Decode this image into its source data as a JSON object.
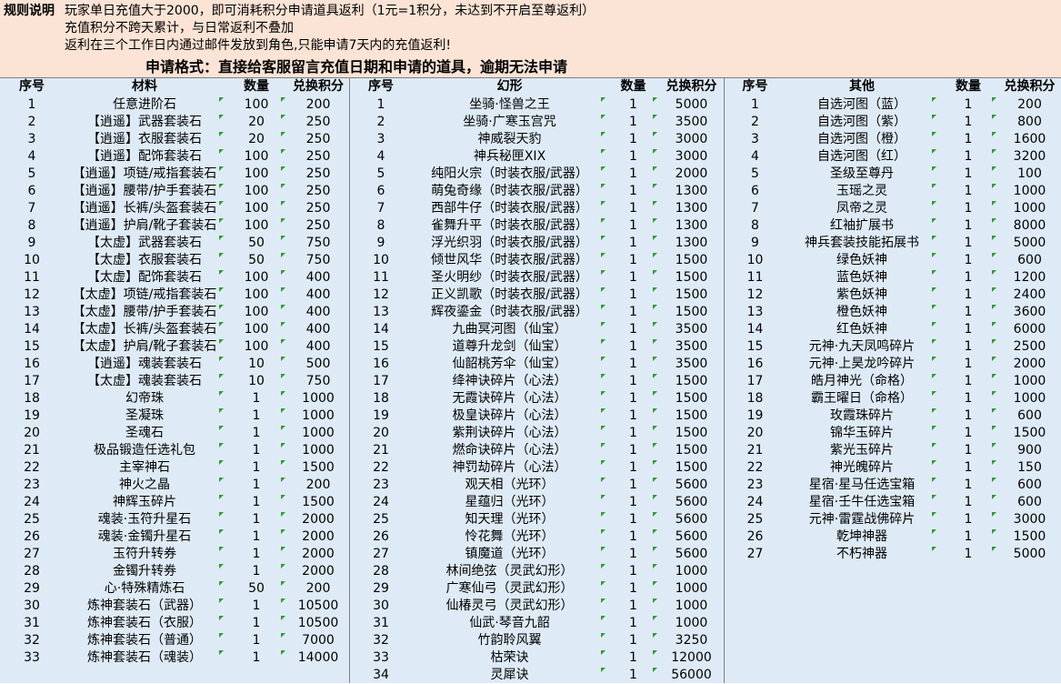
{
  "rules": {
    "label": "规则说明",
    "line1": "玩家单日充值大于2000，即可消耗积分申请道具返利（1元=1积分，未达到不开启至尊返利）",
    "line2": "充值积分不跨天累计，与日常返利不叠加",
    "line3": "返利在三个工作日内通过邮件发放到角色,只能申请7天内的充值返利!",
    "format": "申请格式：直接给客服留言充值日期和申请的道具，逾期无法申请"
  },
  "sections": [
    {
      "headers": [
        "序号",
        "材料",
        "数量",
        "兑换积分"
      ],
      "rows": [
        [
          "1",
          "任意进阶石",
          "100",
          "200"
        ],
        [
          "2",
          "【逍遥】武器套装石",
          "20",
          "250"
        ],
        [
          "3",
          "【逍遥】衣服套装石",
          "20",
          "250"
        ],
        [
          "4",
          "【逍遥】配饰套装石",
          "100",
          "250"
        ],
        [
          "5",
          "【逍遥】项链/戒指套装石",
          "100",
          "250"
        ],
        [
          "6",
          "【逍遥】腰带/护手套装石",
          "100",
          "250"
        ],
        [
          "7",
          "【逍遥】长裤/头盔套装石",
          "100",
          "250"
        ],
        [
          "8",
          "【逍遥】护肩/靴子套装石",
          "100",
          "250"
        ],
        [
          "9",
          "【太虚】武器套装石",
          "50",
          "750"
        ],
        [
          "10",
          "【太虚】衣服套装石",
          "50",
          "750"
        ],
        [
          "11",
          "【太虚】配饰套装石",
          "100",
          "400"
        ],
        [
          "12",
          "【太虚】项链/戒指套装石",
          "100",
          "400"
        ],
        [
          "13",
          "【太虚】腰带/护手套装石",
          "100",
          "400"
        ],
        [
          "14",
          "【太虚】长裤/头盔套装石",
          "100",
          "400"
        ],
        [
          "15",
          "【太虚】护肩/靴子套装石",
          "100",
          "400"
        ],
        [
          "16",
          "【逍遥】魂装套装石",
          "10",
          "500"
        ],
        [
          "17",
          "【太虚】魂装套装石",
          "10",
          "750"
        ],
        [
          "18",
          "幻帝珠",
          "1",
          "1000"
        ],
        [
          "19",
          "圣凝珠",
          "1",
          "1000"
        ],
        [
          "20",
          "圣魂石",
          "1",
          "1000"
        ],
        [
          "21",
          "极品锻造任选礼包",
          "1",
          "1000"
        ],
        [
          "22",
          "主宰神石",
          "1",
          "1500"
        ],
        [
          "23",
          "神火之晶",
          "1",
          "200"
        ],
        [
          "24",
          "神辉玉碎片",
          "1",
          "1500"
        ],
        [
          "25",
          "魂装·玉符升星石",
          "1",
          "2000"
        ],
        [
          "26",
          "魂装·金镯升星石",
          "1",
          "2000"
        ],
        [
          "27",
          "玉符升转券",
          "1",
          "2000"
        ],
        [
          "28",
          "金镯升转券",
          "1",
          "2000"
        ],
        [
          "29",
          "心·特殊精炼石",
          "50",
          "200"
        ],
        [
          "30",
          "炼神套装石（武器）",
          "1",
          "10500"
        ],
        [
          "31",
          "炼神套装石（衣服）",
          "1",
          "10500"
        ],
        [
          "32",
          "炼神套装石（普通）",
          "1",
          "7000"
        ],
        [
          "33",
          "炼神套装石（魂装）",
          "1",
          "14000"
        ]
      ]
    },
    {
      "headers": [
        "序号",
        "幻形",
        "数量",
        "兑换积分"
      ],
      "rows": [
        [
          "1",
          "坐骑·怪兽之王",
          "1",
          "5000"
        ],
        [
          "2",
          "坐骑·广寒玉宫咒",
          "1",
          "3500"
        ],
        [
          "3",
          "神威裂天豹",
          "1",
          "3000"
        ],
        [
          "4",
          "神兵秘匣XIX",
          "1",
          "3000"
        ],
        [
          "5",
          "纯阳火宗（时装衣服/武器）",
          "1",
          "2000"
        ],
        [
          "6",
          "萌兔奇缘（时装衣服/武器）",
          "1",
          "1300"
        ],
        [
          "7",
          "西部牛仔（时装衣服/武器）",
          "1",
          "1300"
        ],
        [
          "8",
          "雀舞升平（时装衣服/武器）",
          "1",
          "1300"
        ],
        [
          "9",
          "浮光织羽（时装衣服/武器）",
          "1",
          "1300"
        ],
        [
          "10",
          "倾世风华（时装衣服/武器）",
          "1",
          "1500"
        ],
        [
          "11",
          "圣火明纱（时装衣服/武器）",
          "1",
          "1500"
        ],
        [
          "12",
          "正义凯歌（时装衣服/武器）",
          "1",
          "1500"
        ],
        [
          "13",
          "辉夜鎏金（时装衣服/武器）",
          "1",
          "1500"
        ],
        [
          "14",
          "九曲冥河图（仙宝）",
          "1",
          "3500"
        ],
        [
          "15",
          "道尊升龙剑（仙宝）",
          "1",
          "3500"
        ],
        [
          "16",
          "仙韶桃芳伞（仙宝）",
          "1",
          "3500"
        ],
        [
          "17",
          "绛神诀碎片（心法）",
          "1",
          "1500"
        ],
        [
          "18",
          "无霞诀碎片（心法）",
          "1",
          "1500"
        ],
        [
          "19",
          "极皇诀碎片（心法）",
          "1",
          "1500"
        ],
        [
          "20",
          "紫荆诀碎片（心法）",
          "1",
          "1500"
        ],
        [
          "21",
          "燃命诀碎片（心法）",
          "1",
          "1500"
        ],
        [
          "22",
          "神罚劫碎片（心法）",
          "1",
          "1500"
        ],
        [
          "23",
          "观天相（光环）",
          "1",
          "5600"
        ],
        [
          "24",
          "星蕴归（光环）",
          "1",
          "5600"
        ],
        [
          "25",
          "知天理（光环）",
          "1",
          "5600"
        ],
        [
          "26",
          "怜花舞（光环）",
          "1",
          "5600"
        ],
        [
          "27",
          "镇魔道（光环）",
          "1",
          "5600"
        ],
        [
          "28",
          "林间绝弦（灵武幻形）",
          "1",
          "1000"
        ],
        [
          "29",
          "广寒仙弓（灵武幻形）",
          "1",
          "1000"
        ],
        [
          "30",
          "仙椿灵弓（灵武幻形）",
          "1",
          "1000"
        ],
        [
          "31",
          "仙武·琴音九韶",
          "1",
          "1000"
        ],
        [
          "32",
          "竹韵聆风翼",
          "1",
          "3250"
        ],
        [
          "33",
          "枯荣诀",
          "1",
          "12000"
        ],
        [
          "34",
          "灵犀诀",
          "1",
          "56000"
        ]
      ]
    },
    {
      "headers": [
        "序号",
        "其他",
        "数量",
        "兑换积分"
      ],
      "rows": [
        [
          "1",
          "自选河图（蓝）",
          "1",
          "200"
        ],
        [
          "2",
          "自选河图（紫）",
          "1",
          "800"
        ],
        [
          "3",
          "自选河图（橙）",
          "1",
          "1600"
        ],
        [
          "4",
          "自选河图（红）",
          "1",
          "3200"
        ],
        [
          "5",
          "圣级至尊丹",
          "1",
          "100"
        ],
        [
          "6",
          "玉瑶之灵",
          "1",
          "1000"
        ],
        [
          "7",
          "凤帝之灵",
          "1",
          "1000"
        ],
        [
          "8",
          "红袖扩展书",
          "1",
          "8000"
        ],
        [
          "9",
          "神兵套装技能拓展书",
          "1",
          "5000"
        ],
        [
          "10",
          "绿色妖神",
          "1",
          "600"
        ],
        [
          "11",
          "蓝色妖神",
          "1",
          "1200"
        ],
        [
          "12",
          "紫色妖神",
          "1",
          "2400"
        ],
        [
          "13",
          "橙色妖神",
          "1",
          "3600"
        ],
        [
          "14",
          "红色妖神",
          "1",
          "6000"
        ],
        [
          "15",
          "元神·九天凤鸣碎片",
          "1",
          "2500"
        ],
        [
          "16",
          "元神·上昊龙吟碎片",
          "1",
          "2000"
        ],
        [
          "17",
          "皓月神光（命格）",
          "1",
          "1000"
        ],
        [
          "18",
          "霸王曜日（命格）",
          "1",
          "1000"
        ],
        [
          "19",
          "玫霞珠碎片",
          "1",
          "600"
        ],
        [
          "20",
          "锦华玉碎片",
          "1",
          "1500"
        ],
        [
          "21",
          "紫光玉碎片",
          "1",
          "900"
        ],
        [
          "22",
          "神光魄碎片",
          "1",
          "150"
        ],
        [
          "23",
          "星宿·星马任选宝箱",
          "1",
          "600"
        ],
        [
          "24",
          "星宿·壬牛任选宝箱",
          "1",
          "600"
        ],
        [
          "25",
          "元神·雷霆战佛碎片",
          "1",
          "3000"
        ],
        [
          "26",
          "乾坤神器",
          "1",
          "1500"
        ],
        [
          "27",
          "不朽神器",
          "1",
          "5000"
        ]
      ]
    }
  ],
  "colors": {
    "header_bg": "#fbe4d5",
    "grid_bg": "#deebf7",
    "comment_mark": "#2e9e2e",
    "grid_line": "#7f7f7f"
  }
}
